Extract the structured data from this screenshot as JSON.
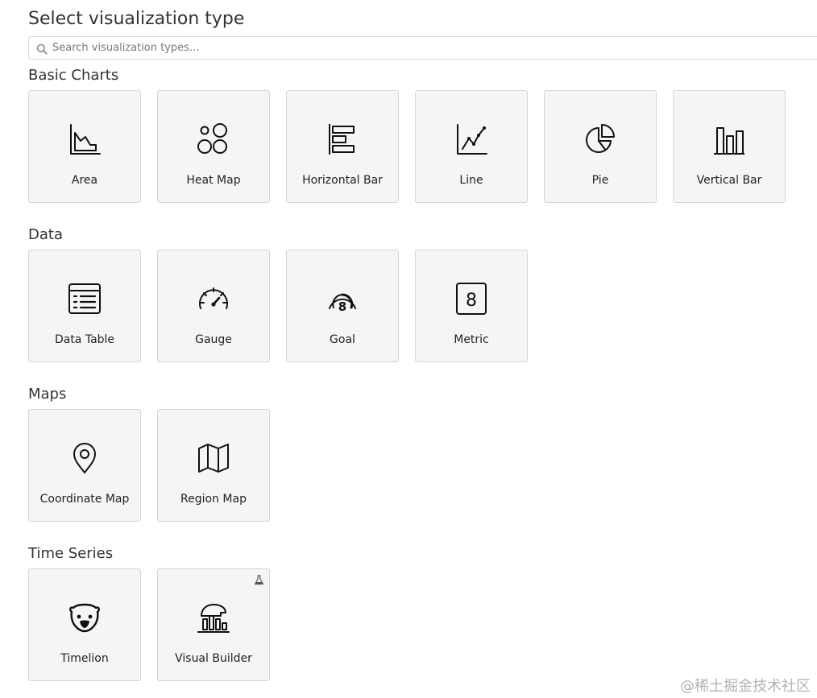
{
  "page_title": "Select visualization type",
  "search": {
    "placeholder": "Search visualization types...",
    "value": ""
  },
  "sections": [
    {
      "title": "Basic Charts",
      "tiles": [
        {
          "label": "Area",
          "icon": "area-chart-icon"
        },
        {
          "label": "Heat Map",
          "icon": "heat-map-icon"
        },
        {
          "label": "Horizontal Bar",
          "icon": "horizontal-bar-icon"
        },
        {
          "label": "Line",
          "icon": "line-chart-icon"
        },
        {
          "label": "Pie",
          "icon": "pie-chart-icon"
        },
        {
          "label": "Vertical Bar",
          "icon": "vertical-bar-icon"
        }
      ]
    },
    {
      "title": "Data",
      "tiles": [
        {
          "label": "Data Table",
          "icon": "data-table-icon"
        },
        {
          "label": "Gauge",
          "icon": "gauge-icon"
        },
        {
          "label": "Goal",
          "icon": "goal-icon"
        },
        {
          "label": "Metric",
          "icon": "metric-icon"
        }
      ]
    },
    {
      "title": "Maps",
      "tiles": [
        {
          "label": "Coordinate Map",
          "icon": "map-pin-icon"
        },
        {
          "label": "Region Map",
          "icon": "region-map-icon"
        }
      ]
    },
    {
      "title": "Time Series",
      "tiles": [
        {
          "label": "Timelion",
          "icon": "timelion-bear-icon"
        },
        {
          "label": "Visual Builder",
          "icon": "visual-builder-icon",
          "badge": "beta-flask-icon"
        }
      ]
    }
  ],
  "watermark": "@稀土掘金技术社区"
}
